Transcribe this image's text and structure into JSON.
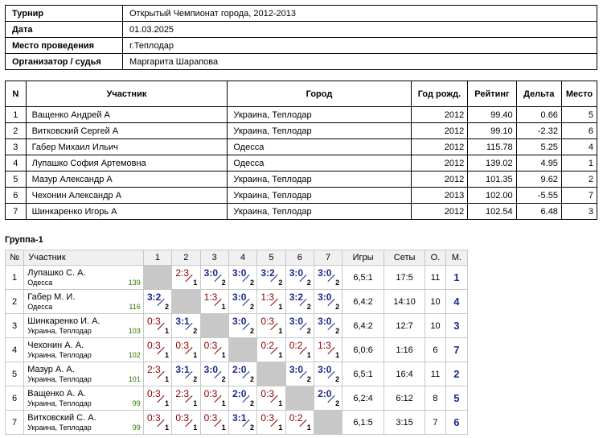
{
  "info": [
    {
      "label": "Турнир",
      "value": "Открытый Чемпионат города, 2012-2013"
    },
    {
      "label": "Дата",
      "value": "01.03.2025"
    },
    {
      "label": "Место проведения",
      "value": "г.Теплодар"
    },
    {
      "label": "Организатор / судья",
      "value": "Маргарита Шарапова"
    }
  ],
  "players_headers": [
    "N",
    "Участник",
    "Город",
    "Год рожд.",
    "Рейтинг",
    "Дельта",
    "Место"
  ],
  "players": [
    {
      "n": "1",
      "name": "Ващенко Андрей А",
      "city": "Украина, Теплодар",
      "year": "2012",
      "rating": "99.40",
      "delta": "0.66",
      "place": "5"
    },
    {
      "n": "2",
      "name": "Витковский Сергей А",
      "city": "Украина, Теплодар",
      "year": "2012",
      "rating": "99.10",
      "delta": "-2.32",
      "place": "6"
    },
    {
      "n": "3",
      "name": "Габер Михаил Ильич",
      "city": "Одесса",
      "year": "2012",
      "rating": "115.78",
      "delta": "5.25",
      "place": "4"
    },
    {
      "n": "4",
      "name": "Лупашко София Артемовна",
      "city": "Одесса",
      "year": "2012",
      "rating": "139.02",
      "delta": "4.95",
      "place": "1"
    },
    {
      "n": "5",
      "name": "Мазур Александр А",
      "city": "Украина, Теплодар",
      "year": "2012",
      "rating": "101.35",
      "delta": "9.62",
      "place": "2"
    },
    {
      "n": "6",
      "name": "Чехонин Александр А",
      "city": "Украина, Теплодар",
      "year": "2013",
      "rating": "102.00",
      "delta": "-5.55",
      "place": "7"
    },
    {
      "n": "7",
      "name": "Шинкаренко Игорь А",
      "city": "Украина, Теплодар",
      "year": "2012",
      "rating": "102.54",
      "delta": "6.48",
      "place": "3"
    }
  ],
  "group_title": "Группа-1",
  "grid_headers": {
    "no": "№",
    "player": "Участник",
    "cols": [
      "1",
      "2",
      "3",
      "4",
      "5",
      "6",
      "7"
    ],
    "games": "Игры",
    "sets": "Сеты",
    "points": "О.",
    "place": "М."
  },
  "grid": [
    {
      "no": "1",
      "name": "Лупашко С. А.",
      "city": "Одесса",
      "rating": "139",
      "cells": [
        null,
        {
          "s": "2:3",
          "p": "1",
          "w": false
        },
        {
          "s": "3:0",
          "p": "2",
          "w": true
        },
        {
          "s": "3:0",
          "p": "2",
          "w": true
        },
        {
          "s": "3:2",
          "p": "2",
          "w": true
        },
        {
          "s": "3:0",
          "p": "2",
          "w": true
        },
        {
          "s": "3:0",
          "p": "2",
          "w": true
        }
      ],
      "games": "6,5:1",
      "sets": "17:5",
      "points": "11",
      "place": "1"
    },
    {
      "no": "2",
      "name": "Габер М. И.",
      "city": "Одесса",
      "rating": "116",
      "cells": [
        {
          "s": "3:2",
          "p": "2",
          "w": true
        },
        null,
        {
          "s": "1:3",
          "p": "1",
          "w": false
        },
        {
          "s": "3:0",
          "p": "2",
          "w": true
        },
        {
          "s": "1:3",
          "p": "1",
          "w": false
        },
        {
          "s": "3:2",
          "p": "2",
          "w": true
        },
        {
          "s": "3:0",
          "p": "2",
          "w": true
        }
      ],
      "games": "6,4:2",
      "sets": "14:10",
      "points": "10",
      "place": "4"
    },
    {
      "no": "3",
      "name": "Шинкаренко И. А.",
      "city": "Украина, Теплодар",
      "rating": "103",
      "cells": [
        {
          "s": "0:3",
          "p": "1",
          "w": false
        },
        {
          "s": "3:1",
          "p": "2",
          "w": true
        },
        null,
        {
          "s": "3:0",
          "p": "2",
          "w": true
        },
        {
          "s": "0:3",
          "p": "1",
          "w": false
        },
        {
          "s": "3:0",
          "p": "2",
          "w": true
        },
        {
          "s": "3:0",
          "p": "2",
          "w": true
        }
      ],
      "games": "6,4:2",
      "sets": "12:7",
      "points": "10",
      "place": "3"
    },
    {
      "no": "4",
      "name": "Чехонин А. А.",
      "city": "Украина, Теплодар",
      "rating": "102",
      "cells": [
        {
          "s": "0:3",
          "p": "1",
          "w": false
        },
        {
          "s": "0:3",
          "p": "1",
          "w": false
        },
        {
          "s": "0:3",
          "p": "1",
          "w": false
        },
        null,
        {
          "s": "0:2",
          "p": "1",
          "w": false
        },
        {
          "s": "0:2",
          "p": "1",
          "w": false
        },
        {
          "s": "1:3",
          "p": "1",
          "w": false
        }
      ],
      "games": "6,0:6",
      "sets": "1:16",
      "points": "6",
      "place": "7"
    },
    {
      "no": "5",
      "name": "Мазур А. А.",
      "city": "Украина, Теплодар",
      "rating": "101",
      "cells": [
        {
          "s": "2:3",
          "p": "1",
          "w": false
        },
        {
          "s": "3:1",
          "p": "2",
          "w": true
        },
        {
          "s": "3:0",
          "p": "2",
          "w": true
        },
        {
          "s": "2:0",
          "p": "2",
          "w": true
        },
        null,
        {
          "s": "3:0",
          "p": "2",
          "w": true
        },
        {
          "s": "3:0",
          "p": "2",
          "w": true
        }
      ],
      "games": "6,5:1",
      "sets": "16:4",
      "points": "11",
      "place": "2"
    },
    {
      "no": "6",
      "name": "Ващенко А. А.",
      "city": "Украина, Теплодар",
      "rating": "99",
      "cells": [
        {
          "s": "0:3",
          "p": "1",
          "w": false
        },
        {
          "s": "2:3",
          "p": "1",
          "w": false
        },
        {
          "s": "0:3",
          "p": "1",
          "w": false
        },
        {
          "s": "2:0",
          "p": "2",
          "w": true
        },
        {
          "s": "0:3",
          "p": "1",
          "w": false
        },
        null,
        {
          "s": "2:0",
          "p": "2",
          "w": true
        }
      ],
      "games": "6,2:4",
      "sets": "6:12",
      "points": "8",
      "place": "5"
    },
    {
      "no": "7",
      "name": "Витковский С. А.",
      "city": "Украина, Теплодар",
      "rating": "99",
      "cells": [
        {
          "s": "0:3",
          "p": "1",
          "w": false
        },
        {
          "s": "0:3",
          "p": "1",
          "w": false
        },
        {
          "s": "0:3",
          "p": "1",
          "w": false
        },
        {
          "s": "3:1",
          "p": "2",
          "w": true
        },
        {
          "s": "0:3",
          "p": "1",
          "w": false
        },
        {
          "s": "0:2",
          "p": "1",
          "w": false
        },
        null
      ],
      "games": "6,1:5",
      "sets": "3:15",
      "points": "7",
      "place": "6"
    }
  ]
}
